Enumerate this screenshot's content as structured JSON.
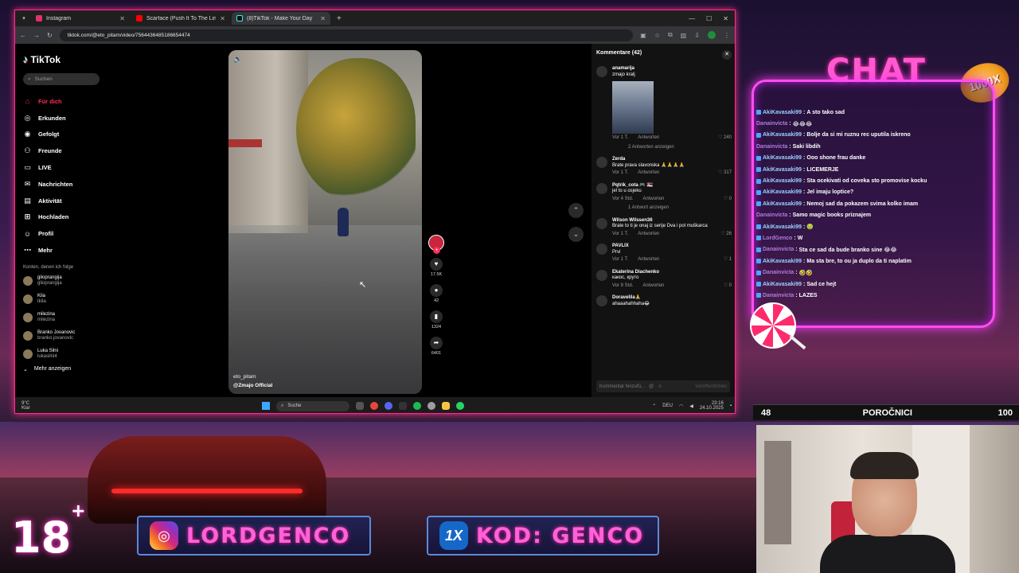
{
  "browser": {
    "tabs": [
      {
        "title": "Instagram",
        "color": "#e1306c",
        "active": false
      },
      {
        "title": "Scarface (Push It To The Limit)",
        "color": "#ff0000",
        "active": false
      },
      {
        "title": "(8)TikTok - Make Your Day",
        "color": "#111111",
        "active": true
      }
    ],
    "url": "tiktok.com/@eto_pitam/video/7564436485186654474"
  },
  "sidebar": {
    "logo": "TikTok",
    "search_placeholder": "Suchen",
    "nav": [
      {
        "label": "Für dich",
        "icon": "home-icon",
        "glyph": "⌂",
        "active": true
      },
      {
        "label": "Erkunden",
        "icon": "compass-icon",
        "glyph": "◎",
        "active": false
      },
      {
        "label": "Gefolgt",
        "icon": "following-icon",
        "glyph": "◉",
        "active": false
      },
      {
        "label": "Freunde",
        "icon": "friends-icon",
        "glyph": "⚇",
        "active": false
      },
      {
        "label": "LIVE",
        "icon": "live-icon",
        "glyph": "▭",
        "active": false
      },
      {
        "label": "Nachrichten",
        "icon": "messages-icon",
        "glyph": "✉",
        "active": false
      },
      {
        "label": "Aktivität",
        "icon": "activity-icon",
        "glyph": "▤",
        "active": false
      },
      {
        "label": "Hochladen",
        "icon": "upload-icon",
        "glyph": "⊞",
        "active": false
      },
      {
        "label": "Profil",
        "icon": "profile-icon",
        "glyph": "☺",
        "active": false
      },
      {
        "label": "Mehr",
        "icon": "more-icon",
        "glyph": "⋯",
        "active": false
      }
    ],
    "following_title": "Konten, denen ich folge",
    "accounts": [
      {
        "name": "glioprangija",
        "handle": "glioprangija"
      },
      {
        "name": "Kila",
        "handle": "tkila"
      },
      {
        "name": "milezina",
        "handle": "milezina"
      },
      {
        "name": "Branko Jovanovic",
        "handle": "branko.jovanovic"
      },
      {
        "name": "Luka Silni",
        "handle": "lukasilni4"
      }
    ],
    "more_accounts": "Mehr anzeigen"
  },
  "video": {
    "author": "eto_pitam",
    "sound": "@Zmajo Official",
    "counts": {
      "likes": "17.5K",
      "comments": "42",
      "saves": "1324",
      "shares": "6401"
    }
  },
  "comments": {
    "title": "Kommentare (42)",
    "items": [
      {
        "user": "anamarija",
        "text": "zmajo kralj",
        "time": "Vor 1 T.",
        "likes": "240",
        "replies": "2 Antworten anzeigen",
        "image": true
      },
      {
        "user": "Zerda",
        "text": "Brate prava slavonska 🙏🙏🙏🙏",
        "time": "Vor 1 T.",
        "likes": "317",
        "replies": "",
        "image": false
      },
      {
        "user": "Pqtrik_cota 🎮 🇷🇸",
        "text": "jel to u osjeku",
        "time": "Vor 4 Std.",
        "likes": "0",
        "replies": "1 Antwort anzeigen",
        "image": false
      },
      {
        "user": "Wilson Wilssen36",
        "text": "Brate to ti je onaj iz serije Dva i pol muškarca",
        "time": "Vor 1 T.",
        "likes": "26",
        "replies": "",
        "image": false
      },
      {
        "user": "PAVLIX",
        "text": "Prvi",
        "time": "Vor 1 T.",
        "likes": "1",
        "replies": "",
        "image": false
      },
      {
        "user": "Ekaterina Diachenko",
        "text": "какос, круто",
        "time": "Vor 8 Std.",
        "likes": "0",
        "replies": "",
        "image": false
      },
      {
        "user": "Doravelila🙏",
        "text": "ahaaahahhaha😂",
        "time": "",
        "likes": "",
        "replies": "",
        "image": false
      }
    ],
    "reply_label": "Antworten",
    "input_placeholder": "Kommentar hinzufü...",
    "publish": "Veröffentlichen"
  },
  "taskbar": {
    "weather_temp": "9°C",
    "weather_text": "Klar",
    "search": "Suche",
    "lang": "DEU",
    "time": "23:16",
    "date": "24.10.2025"
  },
  "chat": {
    "title": "CHAT",
    "badge": "1000X",
    "lines": [
      {
        "user": "AkiKavasaki99",
        "msg": "A sto tako sad",
        "icon": true
      },
      {
        "user": "Danainvicta",
        "msg": "😂😂😂",
        "icon": false
      },
      {
        "user": "AkiKavasaki99",
        "msg": "Bolje da si mi ruznu rec uputila iskreno",
        "icon": true
      },
      {
        "user": "Danainvicta",
        "msg": "Saki libdih",
        "icon": false
      },
      {
        "user": "AkiKavasaki99",
        "msg": "Ooo shone frau danke",
        "icon": true
      },
      {
        "user": "AkiKavasaki99",
        "msg": "LICEMERJE",
        "icon": true
      },
      {
        "user": "AkiKavasaki99",
        "msg": "Sta ocekivati od coveka sto promovise kocku",
        "icon": true
      },
      {
        "user": "AkiKavasaki99",
        "msg": "Jel imaju loptice?",
        "icon": true
      },
      {
        "user": "AkiKavasaki99",
        "msg": "Nemoj sad da pokazem svima kolko imam",
        "icon": true
      },
      {
        "user": "Danainvicta",
        "msg": "Samo magic books priznajem",
        "icon": false
      },
      {
        "user": "AkiKavasaki99",
        "msg": "🤢",
        "icon": true
      },
      {
        "user": "LordGenco",
        "msg": "W",
        "icon": true
      },
      {
        "user": "Danainvicta",
        "msg": "Sta ce sad da bude branko sine 😂😂",
        "icon": true
      },
      {
        "user": "AkiKavasaki99",
        "msg": "Ma sta bre, to ou ja duplo da ti naplatim",
        "icon": true
      },
      {
        "user": "Danainvicta",
        "msg": "🤣🤣",
        "icon": true
      },
      {
        "user": "AkiKavasaki99",
        "msg": "Sad ce hejt",
        "icon": true
      },
      {
        "user": "Danainvicta",
        "msg": "LAZES",
        "icon": true
      }
    ]
  },
  "news": {
    "left": "48",
    "title": "POROČNICI",
    "right": "100"
  },
  "banners": {
    "age": "18",
    "age_plus": "+",
    "instagram": "LORDGENCO",
    "xbet_icon": "1X",
    "code": "KOD: GENCO"
  }
}
